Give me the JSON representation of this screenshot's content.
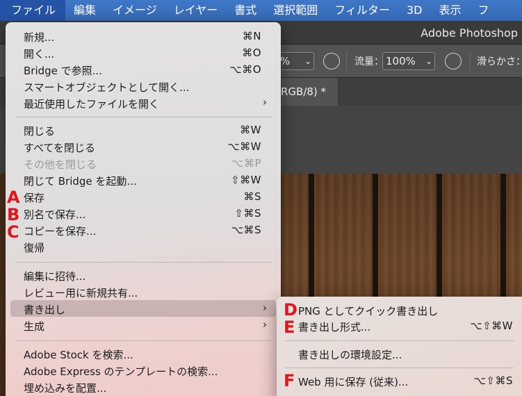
{
  "menubar": {
    "items": [
      "ファイル",
      "編集",
      "イメージ",
      "レイヤー",
      "書式",
      "選択範囲",
      "フィルター",
      "3D",
      "表示",
      "フ"
    ]
  },
  "app_title": "Adobe Photoshop",
  "options_bar": {
    "opacity_value": "%",
    "flow_label": "流量：",
    "flow_value": "100%",
    "smoothing_label": "滑らかさ："
  },
  "doc_tab": {
    "label": "RGB/8) *"
  },
  "file_menu": {
    "items": [
      {
        "label": "新規...",
        "shortcut": "⌘N"
      },
      {
        "label": "開く...",
        "shortcut": "⌘O"
      },
      {
        "label": "Bridge で参照...",
        "shortcut": "⌥⌘O"
      },
      {
        "label": "スマートオブジェクトとして開く...",
        "shortcut": ""
      },
      {
        "label": "最近使用したファイルを開く",
        "shortcut": "",
        "submenu": "›"
      },
      {
        "label": "閉じる",
        "shortcut": "⌘W"
      },
      {
        "label": "すべてを閉じる",
        "shortcut": "⌥⌘W"
      },
      {
        "label": "その他を閉じる",
        "shortcut": "⌥⌘P",
        "disabled": true
      },
      {
        "label": "閉じて Bridge を起動...",
        "shortcut": "⇧⌘W"
      },
      {
        "label": "保存",
        "shortcut": "⌘S"
      },
      {
        "label": "別名で保存...",
        "shortcut": "⇧⌘S"
      },
      {
        "label": "コピーを保存...",
        "shortcut": "⌥⌘S"
      },
      {
        "label": "復帰",
        "shortcut": ""
      },
      {
        "label": "編集に招待...",
        "shortcut": ""
      },
      {
        "label": "レビュー用に新規共有...",
        "shortcut": ""
      },
      {
        "label": "書き出し",
        "shortcut": "",
        "submenu": "›",
        "highlighted": true
      },
      {
        "label": "生成",
        "shortcut": "",
        "submenu": "›"
      },
      {
        "label": "Adobe Stock を検索...",
        "shortcut": ""
      },
      {
        "label": "Adobe Express のテンプレートの検索...",
        "shortcut": ""
      },
      {
        "label": "埋め込みを配置...",
        "shortcut": ""
      }
    ]
  },
  "export_submenu": {
    "items": [
      {
        "label": "PNG としてクイック書き出し",
        "shortcut": ""
      },
      {
        "label": "書き出し形式...",
        "shortcut": "⌥⇧⌘W"
      },
      {
        "label": "書き出しの環境設定...",
        "shortcut": ""
      },
      {
        "label": "Web 用に保存 (従来)...",
        "shortcut": "⌥⇧⌘S"
      }
    ]
  },
  "annotations": [
    "A",
    "B",
    "C",
    "D",
    "E",
    "F"
  ],
  "colors": {
    "menubar_bg": "#3a6fbf",
    "menubar_active": "#2553a6",
    "annotation_red": "#e3141b",
    "highlight": "#a08c8c"
  }
}
